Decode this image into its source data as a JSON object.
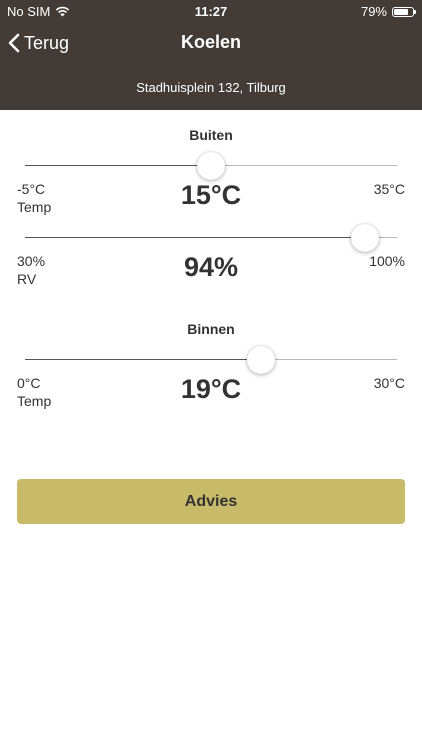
{
  "status_bar": {
    "carrier": "No SIM",
    "time": "11:27",
    "battery_percent": "79%",
    "battery_level": 0.79
  },
  "nav": {
    "back_label": "Terug",
    "title": "Koelen",
    "address": "Stadhuisplein 132, Tilburg"
  },
  "outside": {
    "title": "Buiten",
    "temp": {
      "min_label": "-5°C",
      "max_label": "35°C",
      "caption": "Temp",
      "value_text": "15°C",
      "min": -5,
      "max": 35,
      "value": 15
    },
    "humidity": {
      "min_label": "30%",
      "max_label": "100%",
      "caption": "RV",
      "value_text": "94%",
      "min": 30,
      "max": 100,
      "value": 94
    }
  },
  "inside": {
    "title": "Binnen",
    "temp": {
      "min_label": "0°C",
      "max_label": "30°C",
      "caption": "Temp",
      "value_text": "19°C",
      "min": 0,
      "max": 30,
      "value": 19
    }
  },
  "actions": {
    "advice_label": "Advies"
  },
  "colors": {
    "header": "#433c36",
    "accent_button": "#c7bb6a",
    "text": "#333333"
  }
}
